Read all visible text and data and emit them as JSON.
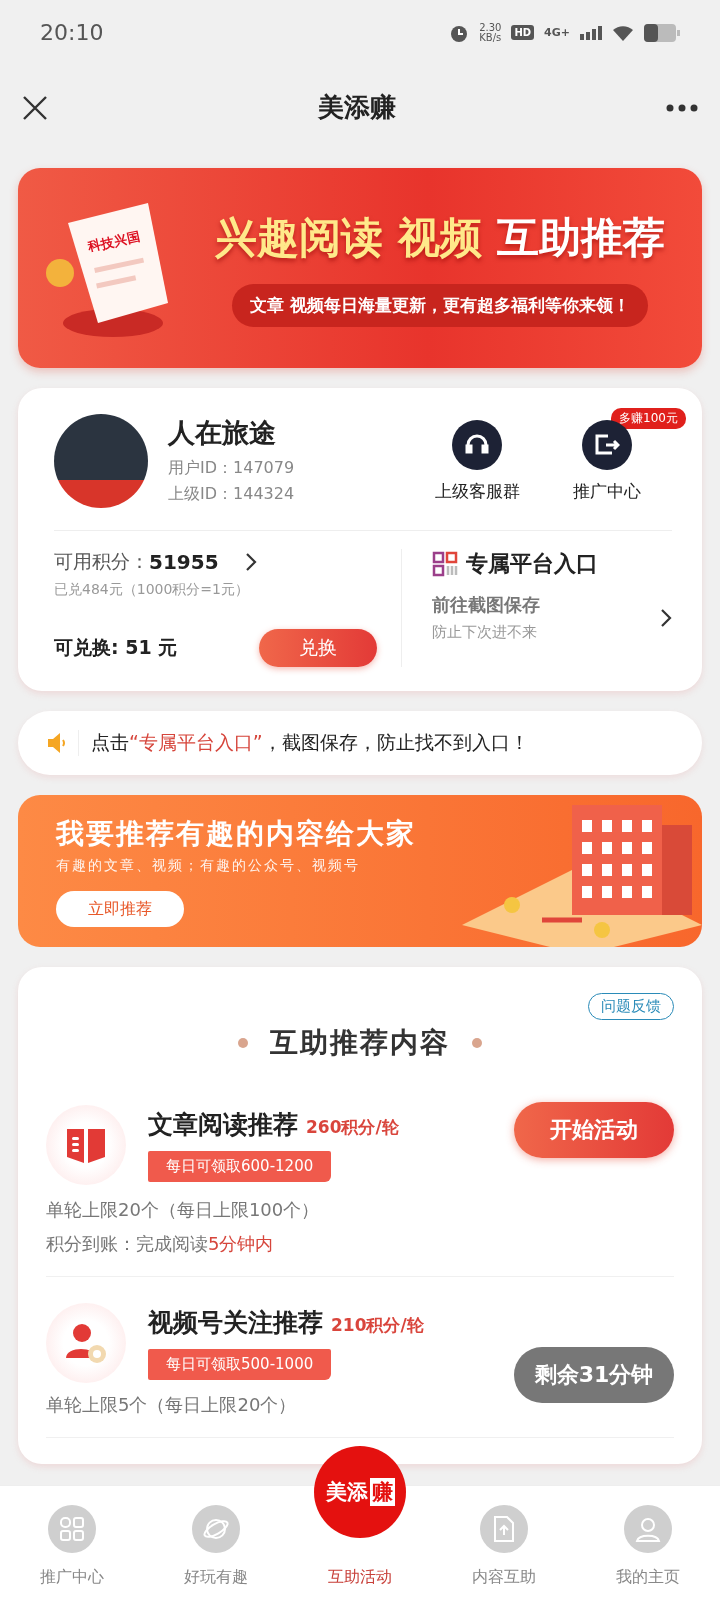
{
  "status_bar": {
    "time": "20:10",
    "speed": "2.30",
    "speed_unit": "KB/s",
    "hd": "HD",
    "network": "4G+"
  },
  "nav": {
    "title": "美添赚"
  },
  "top_banner": {
    "illustration_label": "科技兴国",
    "headline_highlight": "兴趣阅读 视频",
    "headline": "互助推荐",
    "subline": "文章 视频每日海量更新，更有超多福利等你来领！"
  },
  "profile": {
    "name": "人在旅途",
    "user_id": "用户ID：147079",
    "parent_id": "上级ID：144324",
    "actions": [
      {
        "label": "上级客服群"
      },
      {
        "label": "推广中心",
        "badge": "多赚100元"
      }
    ],
    "points_label": "可用积分：",
    "points": "51955",
    "redeemed": "已兑484元（1000积分=1元）",
    "exchangeable": "可兑换: 51 元",
    "exchange_button": "兑换",
    "entry_title": "专属平台入口",
    "entry_action": "前往截图保存",
    "entry_hint": "防止下次进不来"
  },
  "notice": {
    "prefix": "点击",
    "highlight": "“专属平台入口”",
    "suffix": "，截图保存，防止找不到入口！"
  },
  "recommend_banner": {
    "title": "我要推荐有趣的内容给大家",
    "subtitle": "有趣的文章、视频；有趣的公众号、视频号",
    "button": "立即推荐"
  },
  "tasks_section": {
    "feedback": "问题反馈",
    "title": "互助推荐内容",
    "tasks": [
      {
        "kind": "article",
        "title": "文章阅读推荐",
        "points": "260积分/轮",
        "daily": "每日可领取600-1200",
        "limit": "单轮上限20个（每日上限100个）",
        "arrival_prefix": "积分到账：完成阅读",
        "arrival_highlight": "5分钟内",
        "button": "开始活动",
        "available": true
      },
      {
        "kind": "follow",
        "title": "视频号关注推荐",
        "points": "210积分/轮",
        "daily": "每日可领取500-1000",
        "limit": "单轮上限5个（每日上限20个）",
        "button": "剩余31分钟",
        "available": false
      }
    ]
  },
  "bottom_tabs": {
    "logo_text": "美添",
    "logo_boxed": "赚",
    "items": [
      {
        "kind": "grid",
        "label": "推广中心",
        "selected": false
      },
      {
        "kind": "planet",
        "label": "好玩有趣",
        "selected": false
      },
      {
        "kind": "logo",
        "label": "互助活动",
        "selected": true
      },
      {
        "kind": "upload",
        "label": "内容互助",
        "selected": false
      },
      {
        "kind": "person",
        "label": "我的主页",
        "selected": false
      }
    ]
  }
}
